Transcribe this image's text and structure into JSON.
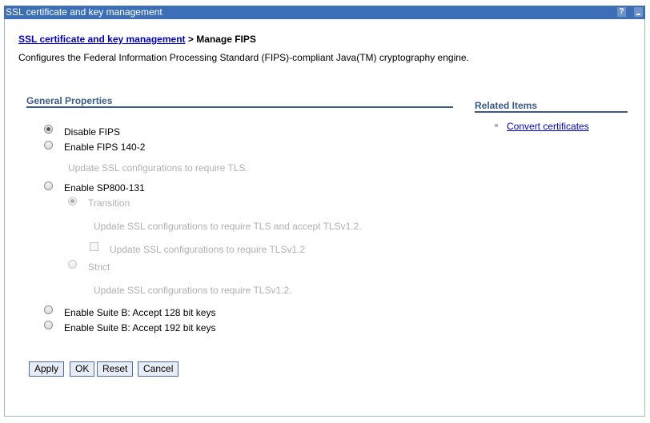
{
  "window": {
    "title": "SSL certificate and key management",
    "help_label": "?"
  },
  "breadcrumb": {
    "link": "SSL certificate and key management",
    "separator": " > ",
    "current": "Manage FIPS"
  },
  "description": "Configures the Federal Information Processing Standard (FIPS)-compliant Java(TM) cryptography engine.",
  "general_properties": {
    "heading": "General Properties",
    "options": {
      "disable_fips": "Disable FIPS",
      "enable_fips_140_2": "Enable FIPS 140-2",
      "fips_140_2_note": "Update SSL configurations to require TLS.",
      "enable_sp800_131": "Enable SP800-131",
      "transition": "Transition",
      "transition_note": "Update SSL configurations to require TLS and accept TLSv1.2.",
      "transition_checkbox": "Update SSL configurations to require TLSv1.2",
      "strict": "Strict",
      "strict_note": "Update SSL configurations to require TLSv1.2.",
      "suite_b_128": "Enable Suite B: Accept 128 bit keys",
      "suite_b_192": "Enable Suite B: Accept 192 bit keys"
    },
    "selected": "Disable FIPS"
  },
  "related_items": {
    "heading": "Related Items",
    "links": [
      "Convert certificates"
    ]
  },
  "buttons": {
    "apply": "Apply",
    "ok": "OK",
    "reset": "Reset",
    "cancel": "Cancel"
  }
}
